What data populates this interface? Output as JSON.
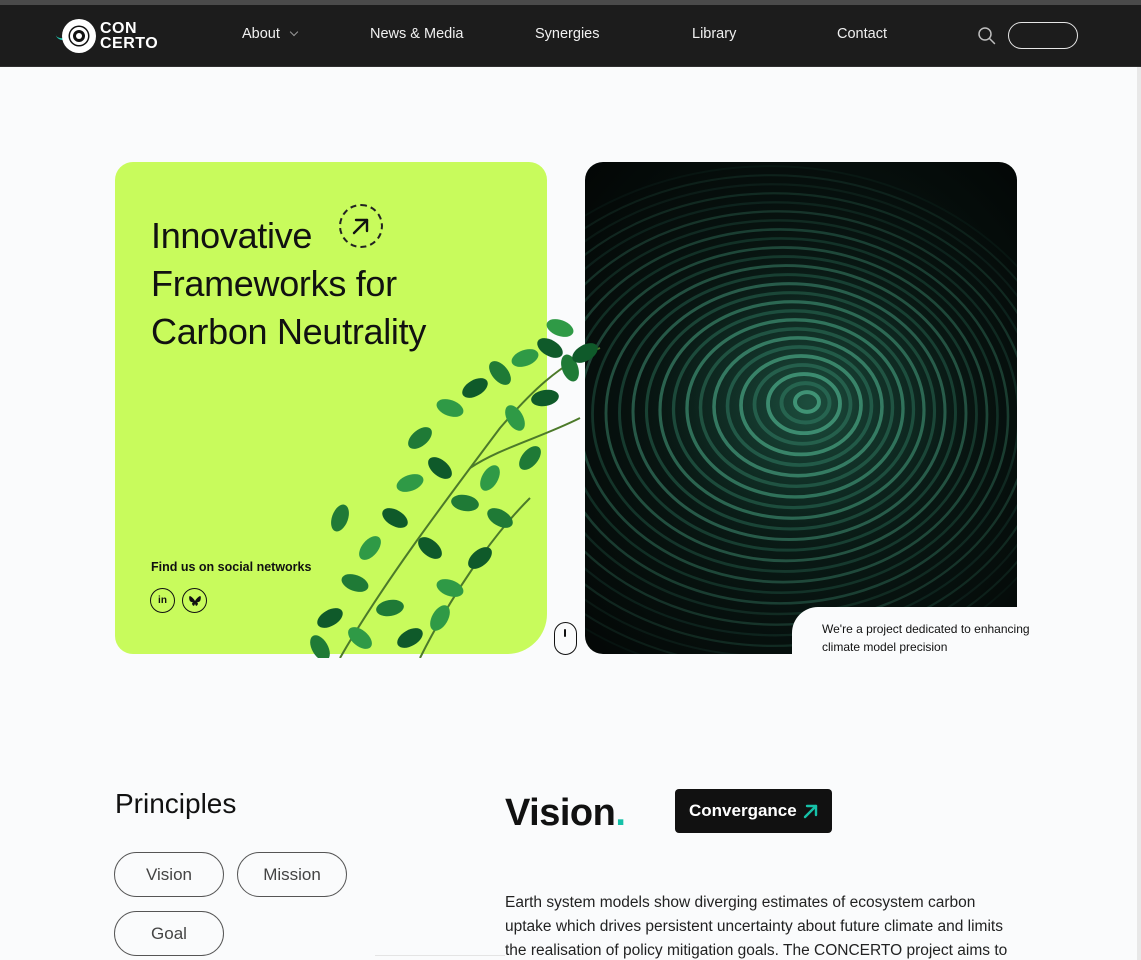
{
  "nav": {
    "logo_line1": "CON",
    "logo_line2": "CERTO",
    "items": [
      {
        "label": "About",
        "has_dropdown": true
      },
      {
        "label": "News & Media"
      },
      {
        "label": "Synergies"
      },
      {
        "label": "Library"
      },
      {
        "label": "Contact"
      }
    ],
    "search_icon": "search-icon"
  },
  "hero": {
    "title_line1": "Innovative",
    "title_line2": "Frameworks for",
    "title_line3": "Carbon Neutrality",
    "social_label": "Find us on social networks",
    "social": [
      {
        "name": "linkedin",
        "glyph": "in"
      },
      {
        "name": "bluesky",
        "glyph": "🦋"
      }
    ],
    "description": "We're a project dedicated to enhancing climate model precision",
    "accent_color": "#c8fb5c"
  },
  "principles": {
    "title": "Principles",
    "tabs": [
      "Vision",
      "Mission",
      "Goal"
    ]
  },
  "vision": {
    "heading": "Vision",
    "dot": ".",
    "button_label": "Convergance",
    "body": "Earth system models show diverging estimates of ecosystem carbon uptake which drives persistent uncertainty about future climate and limits the realisation of policy mitigation goals. The CONCERTO project aims to",
    "accent_color": "#16c1a8"
  }
}
